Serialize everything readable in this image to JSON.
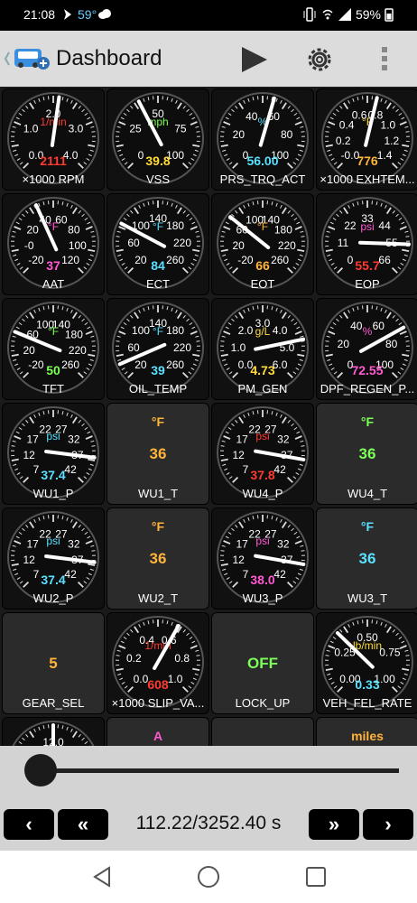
{
  "status": {
    "time": "21:08",
    "temp": "59°",
    "battery": "59%"
  },
  "appbar": {
    "title": "Dashboard"
  },
  "colors": {
    "red": "#ff3b30",
    "green": "#7dff5a",
    "yellow": "#ffdc3c",
    "cyan": "#5ae1ff",
    "orange": "#ffb43c",
    "pink": "#ff5ad2"
  },
  "gauges": [
    {
      "label": "×1000 RPM",
      "value": "2111",
      "unit": "1/min",
      "unit_color": "red",
      "value_color": "red",
      "ticks": [
        "0.0",
        "1.0",
        "2.0",
        "3.0",
        "4.0"
      ],
      "level": 0.53
    },
    {
      "label": "VSS",
      "value": "39.8",
      "unit": "mph",
      "unit_color": "green",
      "value_color": "yellow",
      "ticks": [
        "0",
        "25",
        "50",
        "75",
        "100"
      ],
      "level": 0.398
    },
    {
      "label": "PRS_TRQ_ACT",
      "value": "56.00",
      "unit": "%",
      "unit_color": "cyan",
      "value_color": "cyan",
      "ticks": [
        "0",
        "20",
        "40",
        "60",
        "80",
        "100"
      ],
      "level": 0.56
    },
    {
      "label": "×1000 EXHTEM...",
      "value": "776",
      "unit": "°F",
      "unit_color": "yellow",
      "value_color": "orange",
      "ticks": [
        "-0.0",
        "0.2",
        "0.4",
        "0.6",
        "0.8",
        "1.0",
        "1.2",
        "1.4"
      ],
      "level": 0.55
    },
    {
      "label": "AAT",
      "value": "37",
      "unit": "°F",
      "unit_color": "pink",
      "value_color": "pink",
      "ticks": [
        "-20",
        "-0",
        "20",
        "40",
        "60",
        "80",
        "100",
        "120"
      ],
      "level": 0.41
    },
    {
      "label": "ECT",
      "value": "84",
      "unit": "°F",
      "unit_color": "cyan",
      "value_color": "cyan",
      "ticks": [
        "20",
        "60",
        "100",
        "140",
        "180",
        "220",
        "260"
      ],
      "level": 0.27
    },
    {
      "label": "EOT",
      "value": "66",
      "unit": "°F",
      "unit_color": "orange",
      "value_color": "orange",
      "ticks": [
        "-20",
        "20",
        "60",
        "100",
        "140",
        "180",
        "220",
        "260"
      ],
      "level": 0.31
    },
    {
      "label": "EOP",
      "value": "55.7",
      "unit": "psi",
      "unit_color": "pink",
      "value_color": "red",
      "ticks": [
        "0",
        "11",
        "22",
        "33",
        "44",
        "55",
        "66"
      ],
      "level": 0.84
    },
    {
      "label": "TFT",
      "value": "50",
      "unit": "°F",
      "unit_color": "green",
      "value_color": "green",
      "ticks": [
        "-20",
        "20",
        "60",
        "100",
        "140",
        "180",
        "220",
        "260"
      ],
      "level": 0.25
    },
    {
      "label": "OIL_TEMP",
      "value": "39",
      "unit": "°F",
      "unit_color": "cyan",
      "value_color": "cyan",
      "ticks": [
        "20",
        "60",
        "100",
        "140",
        "180",
        "220",
        "260"
      ],
      "level": 0.08
    },
    {
      "label": "PM_GEN",
      "value": "4.73",
      "unit": "g/L",
      "unit_color": "yellow",
      "value_color": "yellow",
      "ticks": [
        "0.0",
        "1.0",
        "2.0",
        "3.0",
        "4.0",
        "5.0",
        "6.0"
      ],
      "level": 0.79
    },
    {
      "label": "DPF_REGEN_P...",
      "value": "72.55",
      "unit": "%",
      "unit_color": "pink",
      "value_color": "pink",
      "ticks": [
        "0",
        "20",
        "40",
        "60",
        "80",
        "100"
      ],
      "level": 0.7255
    },
    {
      "label": "WU1_P",
      "value": "37.4",
      "unit": "psi",
      "unit_color": "cyan",
      "value_color": "cyan",
      "ticks": [
        "7",
        "12",
        "17",
        "22",
        "27",
        "32",
        "37",
        "42"
      ],
      "level": 0.86
    },
    {
      "label": "WU4_P",
      "value": "37.8",
      "unit": "psi",
      "unit_color": "red",
      "value_color": "red",
      "ticks": [
        "7",
        "12",
        "17",
        "22",
        "27",
        "32",
        "37",
        "42"
      ],
      "level": 0.87
    },
    {
      "label": "WU2_P",
      "value": "37.4",
      "unit": "psi",
      "unit_color": "cyan",
      "value_color": "cyan",
      "ticks": [
        "7",
        "12",
        "17",
        "22",
        "27",
        "32",
        "37",
        "42"
      ],
      "level": 0.86
    },
    {
      "label": "WU3_P",
      "value": "38.0",
      "unit": "psi",
      "unit_color": "pink",
      "value_color": "pink",
      "ticks": [
        "7",
        "12",
        "17",
        "22",
        "27",
        "32",
        "37",
        "42"
      ],
      "level": 0.87
    },
    {
      "label": "×1000 SLIP_VA...",
      "value": "608",
      "unit": "1/min",
      "unit_color": "red",
      "value_color": "red",
      "ticks": [
        "0.0",
        "0.2",
        "0.4",
        "0.6",
        "0.8",
        "1.0"
      ],
      "level": 0.61
    },
    {
      "label": "VEH_FEL_RATE",
      "value": "0.33",
      "unit": "lb/min",
      "unit_color": "yellow",
      "value_color": "cyan",
      "ticks": [
        "0.00",
        "0.25",
        "0.50",
        "0.75",
        "1.00"
      ],
      "level": 0.33
    },
    {
      "label": "",
      "value": "",
      "unit": "",
      "unit_color": "yellow",
      "value_color": "yellow",
      "ticks": [
        "12.0"
      ],
      "level": 0.5
    }
  ],
  "digitals": [
    {
      "label": "WU1_T",
      "value": "36",
      "unit": "°F",
      "color": "orange"
    },
    {
      "label": "WU4_T",
      "value": "36",
      "unit": "°F",
      "color": "green"
    },
    {
      "label": "WU2_T",
      "value": "36",
      "unit": "°F",
      "color": "orange"
    },
    {
      "label": "WU3_T",
      "value": "36",
      "unit": "°F",
      "color": "cyan"
    },
    {
      "label": "GEAR_SEL",
      "value": "5",
      "unit": "",
      "color": "orange"
    },
    {
      "label": "LOCK_UP",
      "value": "OFF",
      "unit": "",
      "color": "green"
    },
    {
      "label": "",
      "value": "",
      "unit": "A",
      "color": "pink"
    },
    {
      "label": "",
      "value": "",
      "unit": "",
      "color": "orange"
    },
    {
      "label": "",
      "value": "",
      "unit": "miles",
      "color": "orange"
    }
  ],
  "playback": {
    "position": "112.22/3252.40 s",
    "progress": 0.0345
  },
  "buttons": {
    "prev": "‹",
    "rewind": "«",
    "forward": "»",
    "next": "›"
  }
}
